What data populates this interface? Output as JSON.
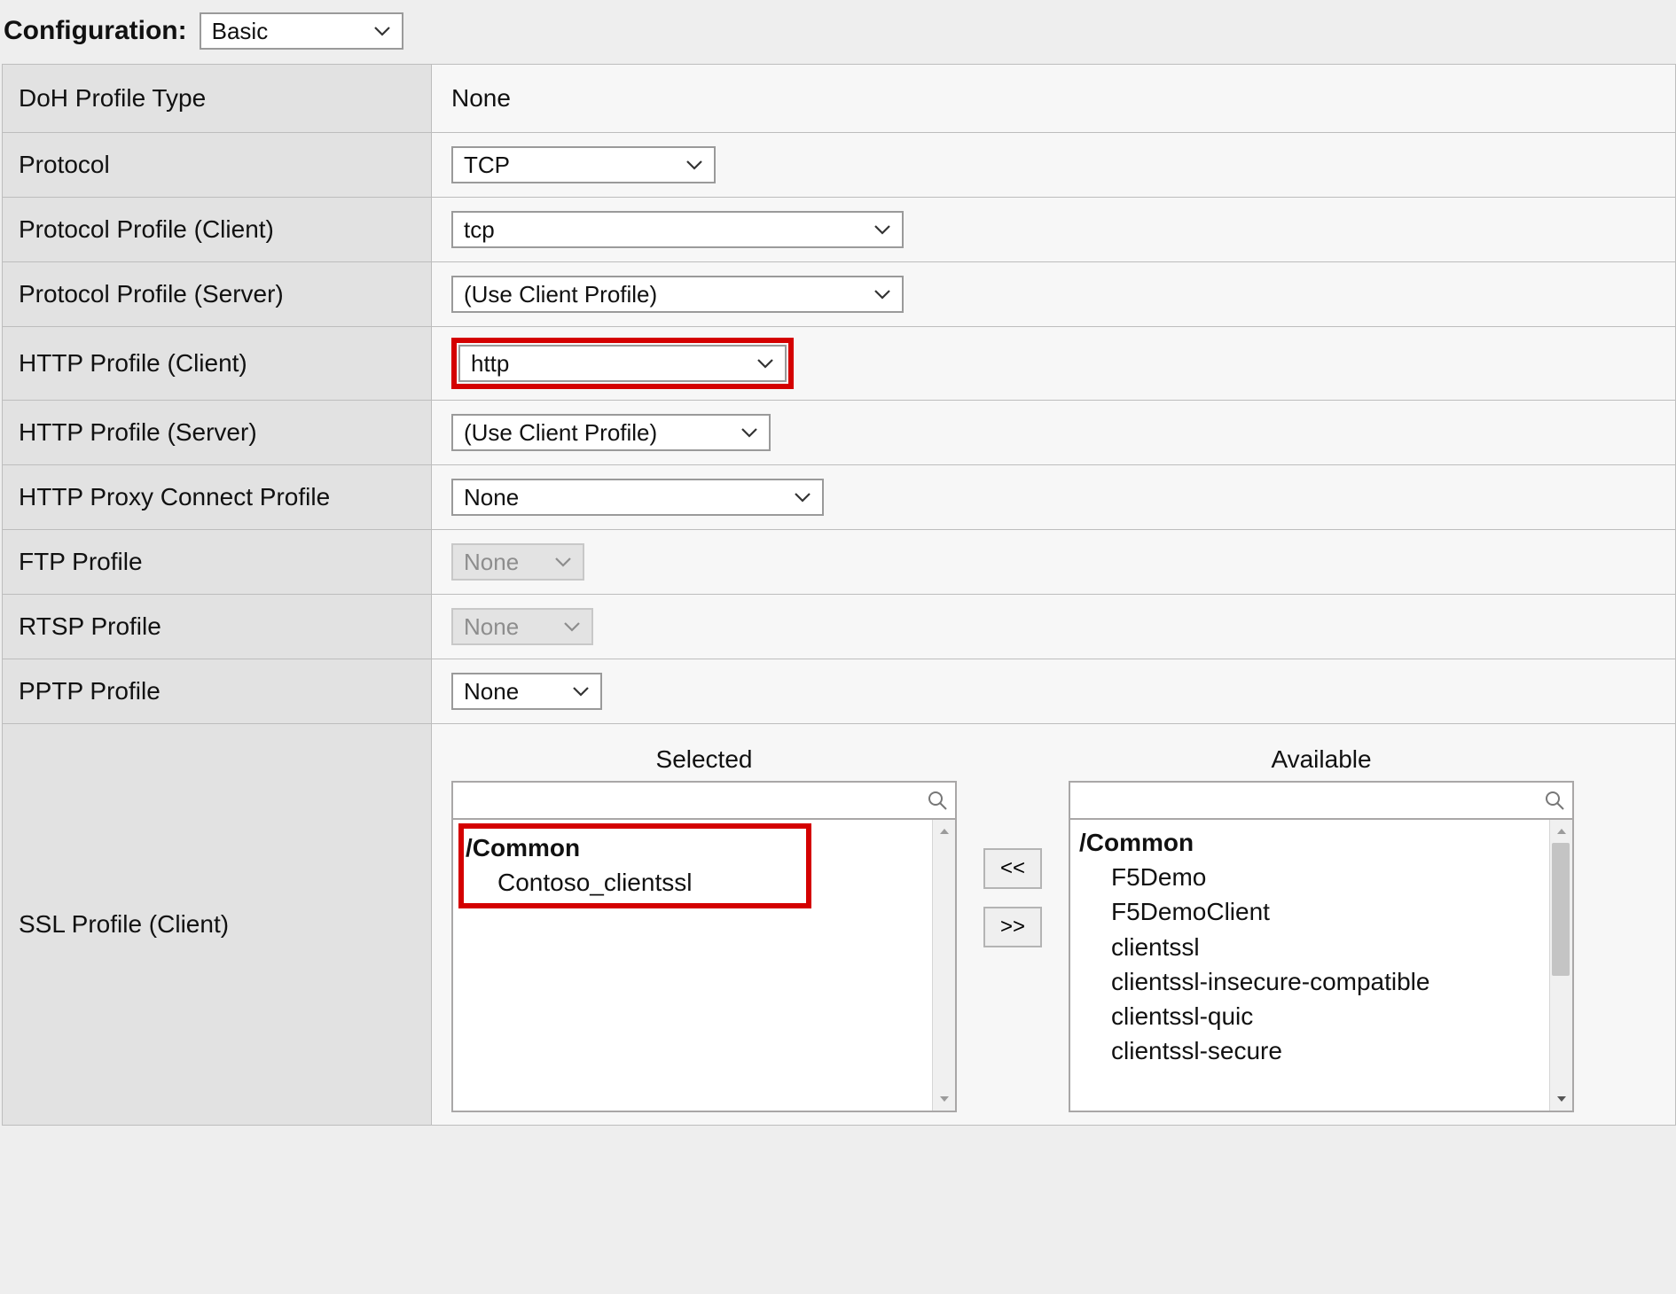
{
  "header": {
    "configuration_label": "Configuration:",
    "configuration_value": "Basic"
  },
  "rows": {
    "doh_profile_type": {
      "label": "DoH Profile Type",
      "value": "None"
    },
    "protocol": {
      "label": "Protocol",
      "value": "TCP"
    },
    "protocol_profile_client": {
      "label": "Protocol Profile (Client)",
      "value": "tcp"
    },
    "protocol_profile_server": {
      "label": "Protocol Profile (Server)",
      "value": "(Use Client Profile)"
    },
    "http_profile_client": {
      "label": "HTTP Profile (Client)",
      "value": "http"
    },
    "http_profile_server": {
      "label": "HTTP Profile (Server)",
      "value": "(Use Client Profile)"
    },
    "http_proxy_connect": {
      "label": "HTTP Proxy Connect Profile",
      "value": "None"
    },
    "ftp_profile": {
      "label": "FTP Profile",
      "value": "None"
    },
    "rtsp_profile": {
      "label": "RTSP Profile",
      "value": "None"
    },
    "pptp_profile": {
      "label": "PPTP Profile",
      "value": "None"
    }
  },
  "ssl_profile_client": {
    "label": "SSL Profile (Client)",
    "selected_header": "Selected",
    "available_header": "Available",
    "group_label": "/Common",
    "selected_items": [
      "Contoso_clientssl"
    ],
    "available_items": [
      "F5Demo",
      "F5DemoClient",
      "clientssl",
      "clientssl-insecure-compatible",
      "clientssl-quic",
      "clientssl-secure"
    ],
    "move_left_label": "<<",
    "move_right_label": ">>"
  }
}
